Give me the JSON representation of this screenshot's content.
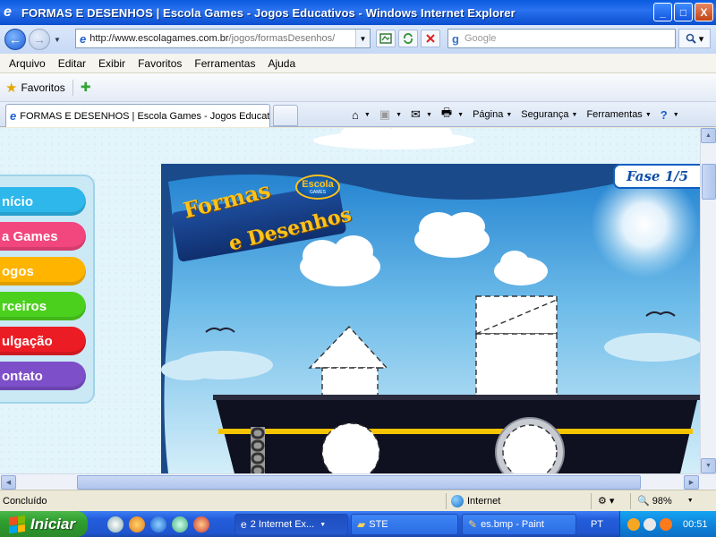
{
  "window": {
    "title": "FORMAS E DESENHOS | Escola Games - Jogos Educativos - Windows Internet Explorer",
    "minimize": "_",
    "maximize": "□",
    "close": "X"
  },
  "address": {
    "url_prefix": "http://www.escolagames.com.br",
    "url_path": "/jogos/formasDesenhos/",
    "search_placeholder": "Google"
  },
  "menu": [
    "Arquivo",
    "Editar",
    "Exibir",
    "Favoritos",
    "Ferramentas",
    "Ajuda"
  ],
  "favorites": {
    "label": "Favoritos"
  },
  "tab": {
    "label": "FORMAS E DESENHOS | Escola Games - Jogos Educati..."
  },
  "commands": {
    "page": "Página",
    "security": "Segurança",
    "tools": "Ferramentas"
  },
  "game": {
    "logo_line1": "Formas",
    "logo_line2": "e Desenhos",
    "badge": "Escola",
    "badge_sub": "GAMES",
    "phase": "Fase 1/5"
  },
  "sidemenu": [
    {
      "label": "nício",
      "color": "#2db7ea"
    },
    {
      "label": "a Games",
      "color": "#f2467e"
    },
    {
      "label": "ogos",
      "color": "#ffb400"
    },
    {
      "label": "rceiros",
      "color": "#4cd01e"
    },
    {
      "label": "ulgação",
      "color": "#ec1c24"
    },
    {
      "label": "ontato",
      "color": "#7d4fc9"
    }
  ],
  "status": {
    "text": "Concluído",
    "zone": "Internet",
    "zoom": "98%"
  },
  "taskbar": {
    "start": "Iniciar",
    "buttons": [
      "2 Internet Ex...",
      "STE",
      "es.bmp - Paint"
    ],
    "lang": "PT",
    "clock": "00:51"
  }
}
